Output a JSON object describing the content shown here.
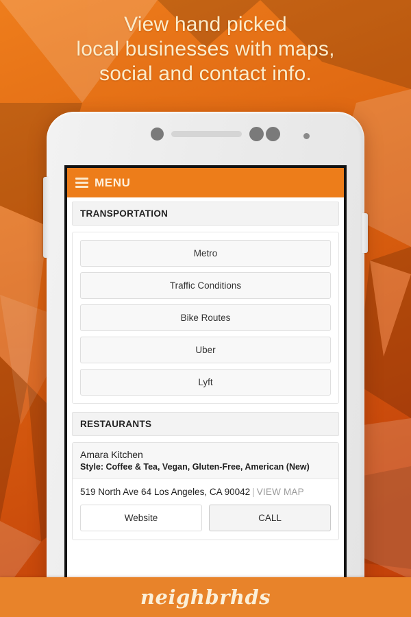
{
  "headline": {
    "line1": "View hand picked",
    "line2": "local businesses with maps,",
    "line3": "social and contact info."
  },
  "colors": {
    "brand_orange": "#ED7D1A",
    "footer_orange": "#E8832A",
    "headline_cream": "#FBECCB",
    "bg_top": "#E8731A",
    "bg_bottom": "#C8450A"
  },
  "phone": {
    "app_bar": {
      "menu_label": "MENU",
      "menu_icon": "hamburger-icon"
    },
    "sections": [
      {
        "header": "TRANSPORTATION",
        "buttons": [
          "Metro",
          "Traffic Conditions",
          "Bike Routes",
          "Uber",
          "Lyft"
        ]
      },
      {
        "header": "RESTAURANTS",
        "cards": [
          {
            "name": "Amara Kitchen",
            "style": "Style: Coffee & Tea, Vegan, Gluten-Free, American (New)",
            "address": "519 North Ave 64 Los Angeles, CA 90042",
            "divider": "|",
            "map_link": "VIEW MAP",
            "website_label": "Website",
            "call_label": "CALL"
          }
        ]
      }
    ]
  },
  "footer": {
    "brand": "neighbrhds"
  }
}
